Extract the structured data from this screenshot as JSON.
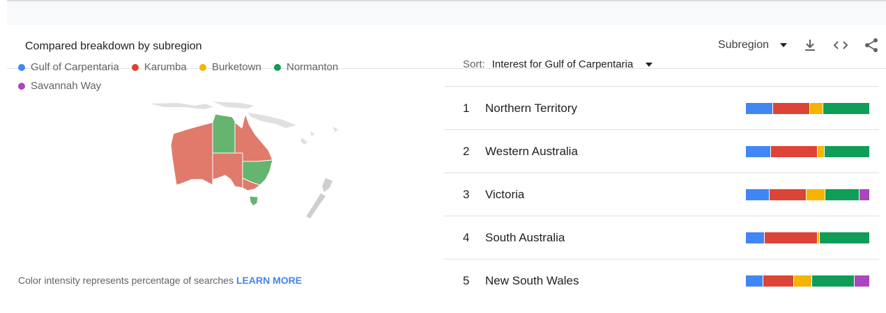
{
  "header": {
    "title": "Compared breakdown by subregion",
    "region_label": "Subregion",
    "icons": [
      "caret-down-icon",
      "download-icon",
      "embed-icon",
      "share-icon"
    ]
  },
  "legend": [
    {
      "label": "Gulf of Carpentaria",
      "color": "#4285f4"
    },
    {
      "label": "Karumba",
      "color": "#db4437"
    },
    {
      "label": "Burketown",
      "color": "#f4b400"
    },
    {
      "label": "Normanton",
      "color": "#0f9d58"
    },
    {
      "label": "Savannah Way",
      "color": "#ab47bc"
    }
  ],
  "map": {
    "winning_term_by_region": {
      "Northern Territory": "Normanton",
      "Western Australia": "Karumba",
      "Queensland": "Karumba",
      "South Australia": "Karumba",
      "New South Wales": "Normanton",
      "Victoria": "Karumba",
      "Tasmania": "Normanton"
    }
  },
  "footnote": {
    "text": "Color intensity represents percentage of searches",
    "link": "LEARN MORE"
  },
  "sort": {
    "label": "Sort:",
    "value": "Interest for Gulf of Carpentaria"
  },
  "rows": [
    {
      "rank": "1",
      "name": "Northern Territory",
      "shares": [
        22,
        30,
        10,
        38,
        0
      ]
    },
    {
      "rank": "2",
      "name": "Western Australia",
      "shares": [
        20,
        38,
        5,
        37,
        0
      ]
    },
    {
      "rank": "3",
      "name": "Victoria",
      "shares": [
        19,
        30,
        15,
        28,
        8
      ]
    },
    {
      "rank": "4",
      "name": "South Australia",
      "shares": [
        15,
        43,
        1,
        41,
        0
      ]
    },
    {
      "rank": "5",
      "name": "New South Wales",
      "shares": [
        14,
        25,
        14,
        35,
        12
      ]
    }
  ]
}
